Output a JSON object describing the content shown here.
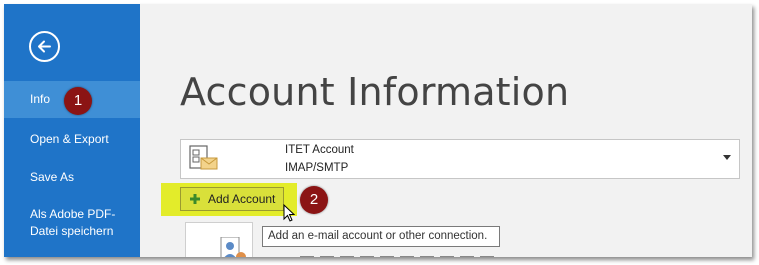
{
  "sidebar": {
    "back_icon": "arrow-left-circle-icon",
    "items": [
      {
        "label": "Info",
        "active": true
      },
      {
        "label": "Open & Export"
      },
      {
        "label": "Save As"
      },
      {
        "label": "Als Adobe PDF-Datei speichern",
        "line1": "Als Adobe PDF-",
        "line2": "Datei speichern"
      }
    ]
  },
  "badges": {
    "one": "1",
    "two": "2"
  },
  "main": {
    "title": "Account Information",
    "account": {
      "name": "ITET Account",
      "type": "IMAP/SMTP",
      "icon": "mail-account-icon"
    },
    "add_account_label": "Add Account",
    "tooltip": "Add an e-mail account or other connection."
  },
  "colors": {
    "sidebar": "#1f74c8",
    "sidebar_active": "#3f8fd6",
    "badge": "#8b1414",
    "highlight": "#e3ec2a"
  }
}
